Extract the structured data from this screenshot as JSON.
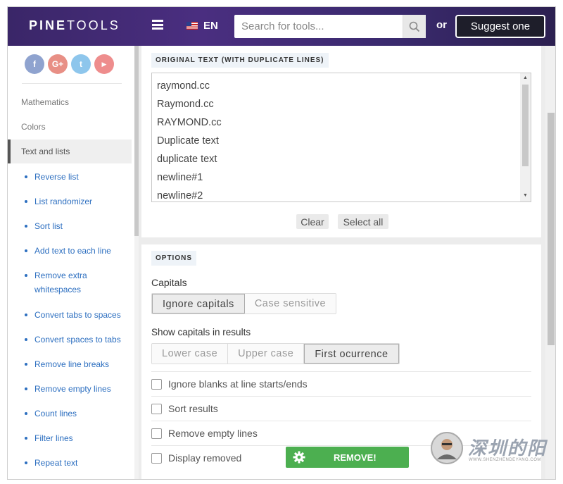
{
  "header": {
    "logo_bold": "PINE",
    "logo_thin": "TOOLS",
    "language": "EN",
    "search_placeholder": "Search for tools...",
    "or_label": "or",
    "suggest_label": "Suggest one"
  },
  "sidebar": {
    "social": [
      {
        "icon": "facebook-icon",
        "glyph": "f",
        "color": "#8fa3cf"
      },
      {
        "icon": "google-plus-icon",
        "glyph": "G+",
        "color": "#e88f85"
      },
      {
        "icon": "twitter-icon",
        "glyph": "t",
        "color": "#8ec6ec"
      },
      {
        "icon": "youtube-icon",
        "glyph": "▶",
        "color": "#ee8d8d"
      }
    ],
    "categories": {
      "mathematics": "Mathematics",
      "colors": "Colors",
      "text_and_lists": "Text and lists"
    },
    "items": [
      "Reverse list",
      "List randomizer",
      "Sort list",
      "Add text to each line",
      "Remove extra whitespaces",
      "Convert tabs to spaces",
      "Convert spaces to tabs",
      "Remove line breaks",
      "Remove empty lines",
      "Count lines",
      "Filter lines",
      "Repeat text"
    ]
  },
  "main": {
    "original_label": "ORIGINAL TEXT (WITH DUPLICATE LINES)",
    "lines": [
      "raymond.cc",
      "Raymond.cc",
      "RAYMOND.cc",
      "Duplicate text",
      "duplicate text",
      "newline#1",
      "newline#2"
    ],
    "clear_label": "Clear",
    "select_all_label": "Select all",
    "options_label": "OPTIONS",
    "capitals_title": "Capitals",
    "capitals_options": [
      "Ignore capitals",
      "Case sensitive"
    ],
    "capitals_selected": "Ignore capitals",
    "show_capitals_title": "Show capitals in results",
    "show_capitals_options": [
      "Lower case",
      "Upper case",
      "First ocurrence"
    ],
    "show_capitals_selected": "First ocurrence",
    "checkboxes": [
      {
        "label": "Ignore blanks at line starts/ends",
        "checked": false
      },
      {
        "label": "Sort results",
        "checked": false
      },
      {
        "label": "Remove empty lines",
        "checked": false
      },
      {
        "label": "Display removed",
        "checked": false
      }
    ],
    "remove_label": "REMOVE!"
  },
  "watermark": {
    "text": "深圳的阳",
    "sub": "WWW.SHENZHENDEYANG.COM"
  }
}
